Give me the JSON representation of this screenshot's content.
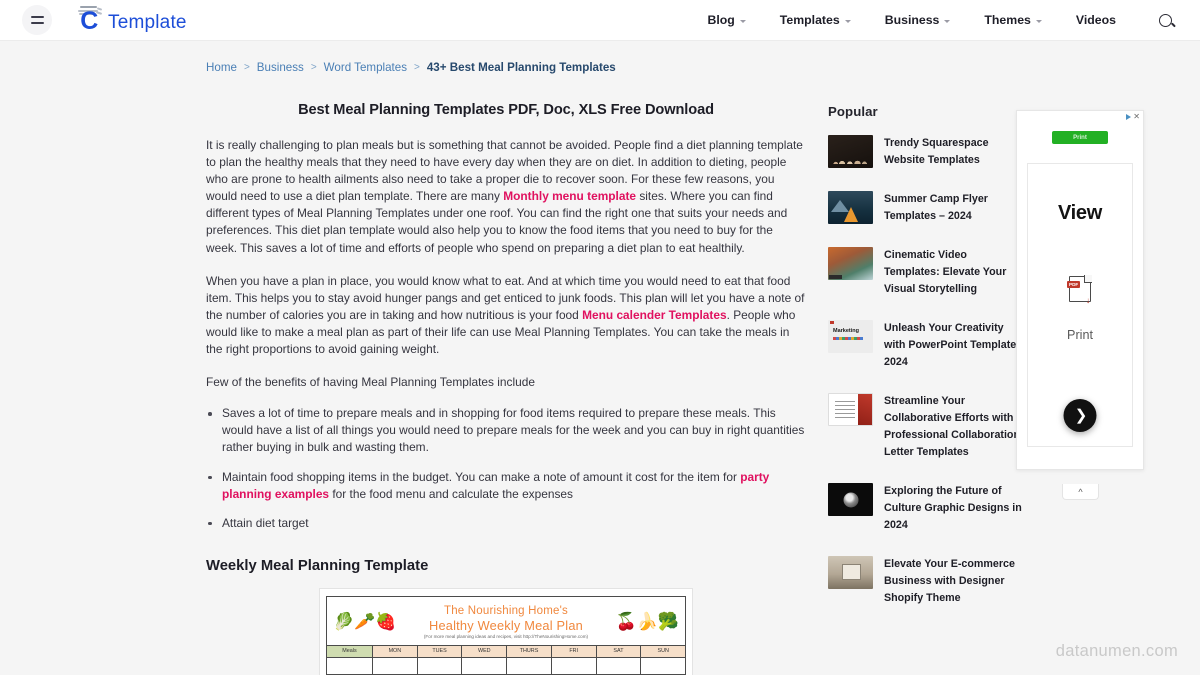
{
  "header": {
    "menu_icon": "hamburger-icon",
    "logo_letter": "C",
    "logo_text": "Template",
    "nav": [
      {
        "label": "Blog",
        "has_caret": true
      },
      {
        "label": "Templates",
        "has_caret": true
      },
      {
        "label": "Business",
        "has_caret": true
      },
      {
        "label": "Themes",
        "has_caret": true
      },
      {
        "label": "Videos",
        "has_caret": false
      }
    ],
    "search_icon": "search-icon"
  },
  "breadcrumb": {
    "items": [
      "Home",
      "Business",
      "Word Templates"
    ],
    "separator": ">",
    "current": "43+ Best Meal Planning Templates"
  },
  "article": {
    "title": "Best Meal Planning Templates PDF, Doc, XLS Free Download",
    "p1_a": "It is really challenging to plan meals but is something that cannot be avoided. People find a diet planning template to plan the healthy meals that they need to have every day when they are on diet. In addition to dieting, people who are prone to health ailments also need to take a proper die to recover soon. For these few reasons, you would need to use a diet plan template. There are many ",
    "p1_link": "Monthly menu template",
    "p1_b": " sites.  Where you can find different types of Meal Planning Templates under one roof. You can find the right one that suits your needs and preferences. This diet plan template would also help you to know the food items that you need to buy for the week. This saves a lot of time and efforts of people who spend on preparing a diet plan to eat healthily.",
    "p2_a": "When you have a plan in place, you would know what to eat. And at which time you would need to eat that food item. This helps you to stay avoid hunger pangs and get enticed to junk foods. This plan will let you have a note of the number of calories you are in taking and how nutritious is your food ",
    "p2_link": "Menu calender Templates",
    "p2_b": ". People who would like to make a meal plan as part of their life can use Meal Planning Templates. You can take the meals in the right proportions to avoid gaining weight.",
    "p3": "Few of the benefits of having Meal Planning Templates include",
    "benefits": [
      {
        "text_a": "Saves a lot of time to prepare meals and in shopping for food items required to prepare these meals. This would have a list of all things you would need to prepare meals for the week and you can buy in right quantities rather buying in bulk and wasting them.",
        "link": "",
        "text_b": ""
      },
      {
        "text_a": "Maintain food shopping items in the budget. You can make a note of amount it cost for the item for ",
        "link": "party planning examples",
        "text_b": " for the food menu and calculate the expenses"
      },
      {
        "text_a": "Attain diet target",
        "link": "",
        "text_b": ""
      }
    ],
    "section_title": "Weekly Meal Planning Template"
  },
  "meal_plan_image": {
    "title_line1": "The Nourishing Home's",
    "title_line2": "Healthy Weekly Meal Plan",
    "subtitle": "(For more meal planning ideas and recipes, visit http://TheNourishingHome.com)",
    "columns": [
      "Meals",
      "MON",
      "TUES",
      "WED",
      "THURS",
      "FRI",
      "SAT",
      "SUN"
    ],
    "left_produce": [
      "asparagus",
      "carrot",
      "strawberry"
    ],
    "right_produce": [
      "cherries",
      "banana",
      "broccoli"
    ]
  },
  "sidebar": {
    "title": "Popular",
    "items": [
      {
        "title": "Trendy Squarespace Website Templates",
        "thumb": "squarespace-thumbnail"
      },
      {
        "title": "Summer Camp Flyer Templates – 2024",
        "thumb": "camp-thumbnail"
      },
      {
        "title": "Cinematic Video Templates: Elevate Your Visual Storytelling",
        "thumb": "cinematic-thumbnail"
      },
      {
        "title": "Unleash Your Creativity with PowerPoint Templates 2024",
        "thumb": "powerpoint-thumbnail"
      },
      {
        "title": "Streamline Your Collaborative Efforts with Professional Collaboration Letter Templates",
        "thumb": "letter-thumbnail"
      },
      {
        "title": "Exploring the Future of Culture Graphic Designs in 2024",
        "thumb": "culture-thumbnail"
      },
      {
        "title": "Elevate Your E-commerce Business with Designer Shopify Theme",
        "thumb": "shopify-thumbnail"
      }
    ]
  },
  "ad": {
    "adchoices_label": "AdChoices",
    "close_label": "✕",
    "cta_label": "Print",
    "headline": "View",
    "icon": "pdf-document-icon",
    "subtext": "Print",
    "next_label": "❯",
    "collapse_label": "^"
  },
  "watermark": "datanumen.com",
  "colors": {
    "brand_blue": "#1d4ed8",
    "link_pink": "#e0115f",
    "breadcrumb_blue": "#4a7fb5",
    "ad_green": "#22b024",
    "page_bg": "#f5f5f5"
  }
}
